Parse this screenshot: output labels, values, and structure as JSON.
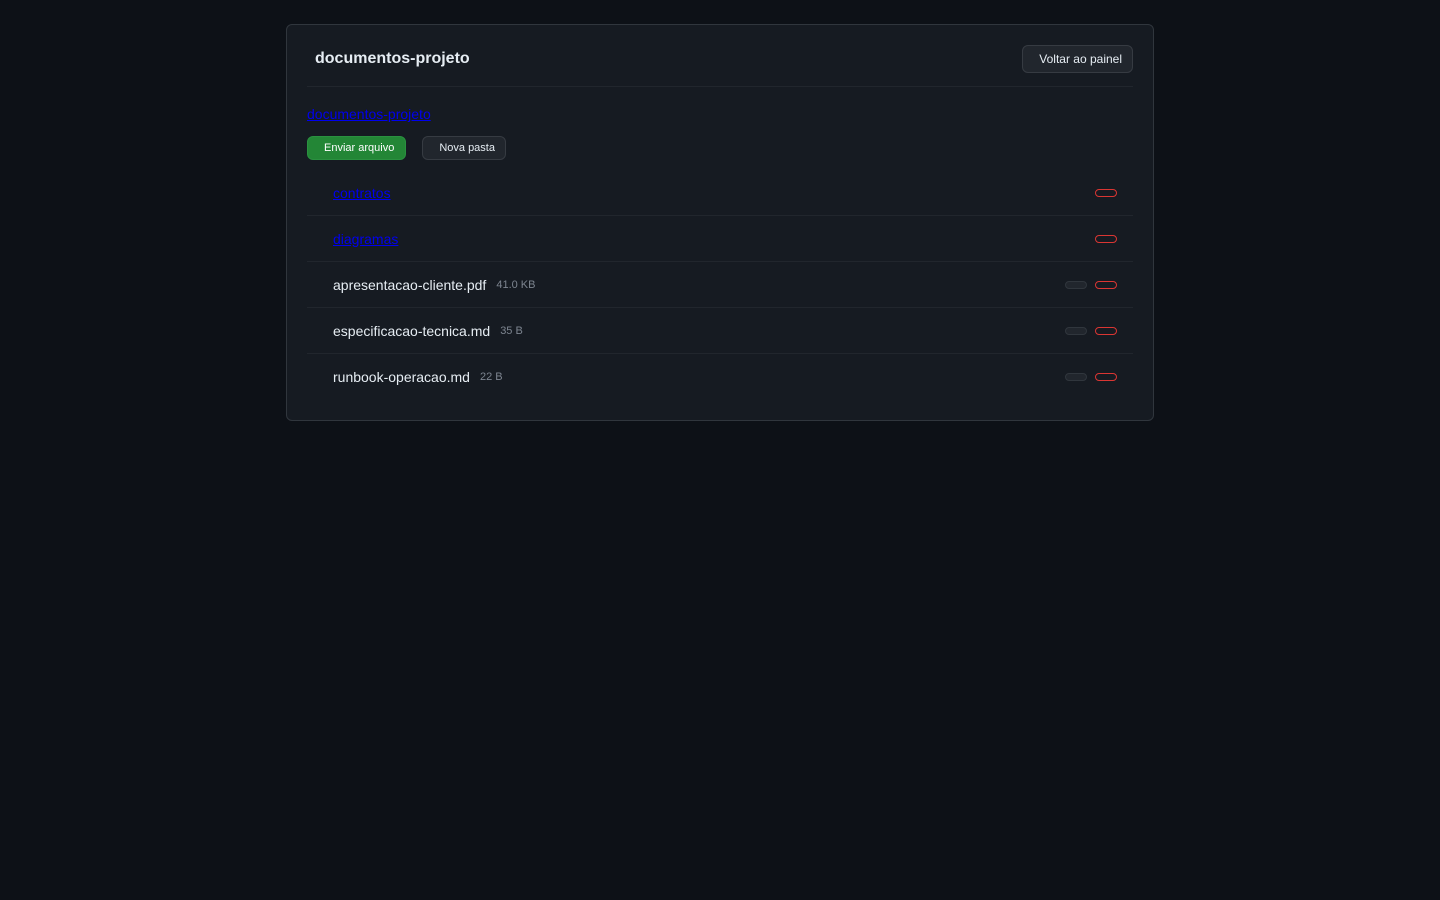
{
  "header": {
    "title": "documentos-projeto",
    "back_label": "Voltar ao painel"
  },
  "breadcrumb": {
    "current": "documentos-projeto"
  },
  "actions": {
    "upload_label": "Enviar arquivo",
    "new_folder_label": "Nova pasta"
  },
  "folders": [
    {
      "name": "contratos"
    },
    {
      "name": "diagramas"
    }
  ],
  "files": [
    {
      "name": "apresentacao-cliente.pdf",
      "size": "41.0 KB"
    },
    {
      "name": "especificacao-tecnica.md",
      "size": "35 B"
    },
    {
      "name": "runbook-operacao.md",
      "size": "22 B"
    }
  ],
  "colors": {
    "background": "#0d1117",
    "panel": "#161b22",
    "primary_button": "#238636",
    "danger_outline": "#da3633",
    "link": "#0000ee"
  }
}
